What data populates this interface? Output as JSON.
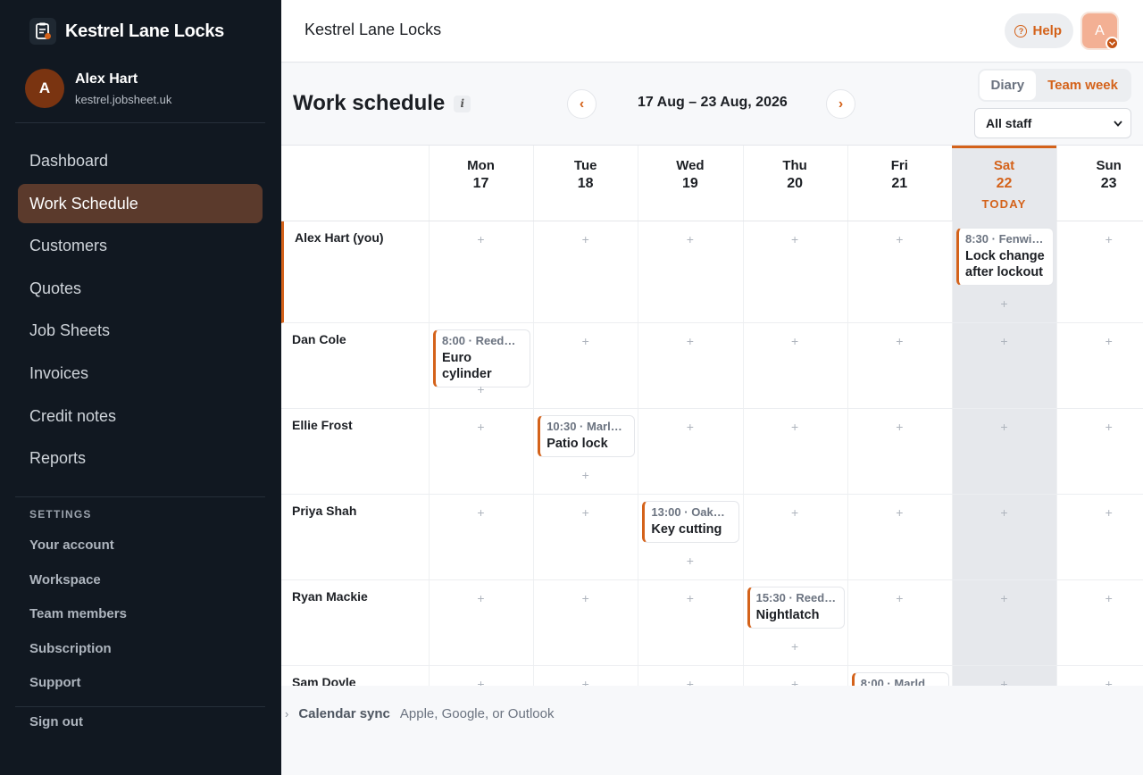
{
  "app": {
    "brand": "Kestrel Lane Locks",
    "accent": "#d4621a"
  },
  "user": {
    "initial": "A",
    "name": "Alex Hart",
    "domain": "kestrel.jobsheet.uk"
  },
  "nav": [
    {
      "label": "Dashboard",
      "name": "nav-dashboard"
    },
    {
      "label": "Work Schedule",
      "name": "nav-work-schedule",
      "active": true
    },
    {
      "label": "Customers",
      "name": "nav-customers"
    },
    {
      "label": "Quotes",
      "name": "nav-quotes"
    },
    {
      "label": "Job Sheets",
      "name": "nav-job-sheets"
    },
    {
      "label": "Invoices",
      "name": "nav-invoices"
    },
    {
      "label": "Credit notes",
      "name": "nav-credit-notes"
    },
    {
      "label": "Reports",
      "name": "nav-reports"
    }
  ],
  "settings": {
    "title": "SETTINGS",
    "items": [
      "Your account",
      "Workspace",
      "Team members",
      "Subscription",
      "Support"
    ]
  },
  "sign_out": "Sign out",
  "topbar": {
    "title": "Kestrel Lane Locks",
    "help": "Help",
    "help_icon": "?",
    "avatar_initial": "A"
  },
  "schedule": {
    "title": "Work schedule",
    "info_icon": "i",
    "prev": "‹",
    "next": "›",
    "date_range": "17 Aug – 23 Aug, 2026",
    "views": [
      "Diary",
      "Team week"
    ],
    "selected_view": "Team week",
    "staff_filter": "All staff"
  },
  "days": [
    {
      "name": "Mon",
      "date": "17"
    },
    {
      "name": "Tue",
      "date": "18"
    },
    {
      "name": "Wed",
      "date": "19"
    },
    {
      "name": "Thu",
      "date": "20"
    },
    {
      "name": "Fri",
      "date": "21"
    },
    {
      "name": "Sat",
      "date": "22",
      "today": true
    },
    {
      "name": "Sun",
      "date": "23"
    }
  ],
  "today_label": "TODAY",
  "staff": [
    {
      "name": "Alex Hart (you)",
      "me": true
    },
    {
      "name": "Dan Cole"
    },
    {
      "name": "Ellie Frost"
    },
    {
      "name": "Priya Shah"
    },
    {
      "name": "Ryan Mackie"
    },
    {
      "name": "Sam Doyle"
    }
  ],
  "jobs": [
    {
      "staff": 0,
      "day": 5,
      "time": "8:30 · Fenwi…",
      "title": "Lock change after lockout"
    },
    {
      "staff": 1,
      "day": 0,
      "time": "8:00 · Reed…",
      "title": "Euro cylinder"
    },
    {
      "staff": 2,
      "day": 1,
      "time": "10:30 · Marl…",
      "title": "Patio lock"
    },
    {
      "staff": 3,
      "day": 2,
      "time": "13:00 · Oak…",
      "title": "Key cutting"
    },
    {
      "staff": 4,
      "day": 3,
      "time": "15:30 · Reed…",
      "title": "Nightlatch"
    },
    {
      "staff": 5,
      "day": 4,
      "time": "8:00 · Marld…",
      "title": ""
    }
  ],
  "add_symbol": "+",
  "sync": {
    "label": "Calendar sync",
    "desc": "Apple, Google, or Outlook",
    "chevron": "›"
  }
}
